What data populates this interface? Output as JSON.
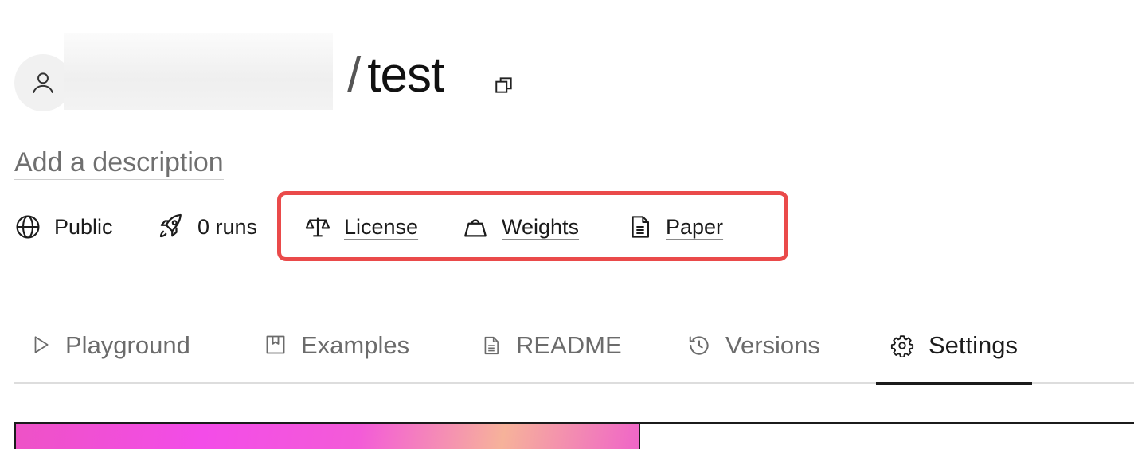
{
  "header": {
    "slash": "/",
    "model_name": "test"
  },
  "description_placeholder": "Add a description",
  "meta": {
    "visibility": "Public",
    "runs": "0 runs",
    "license": "License",
    "weights": "Weights",
    "paper": "Paper"
  },
  "tabs": [
    {
      "label": "Playground",
      "icon": "play-icon"
    },
    {
      "label": "Examples",
      "icon": "bookmark-icon"
    },
    {
      "label": "README",
      "icon": "document-icon"
    },
    {
      "label": "Versions",
      "icon": "history-icon"
    },
    {
      "label": "Settings",
      "icon": "gear-icon",
      "active": true
    }
  ],
  "colors": {
    "highlight": "#ea4a4a",
    "text": "#1b1b1b",
    "muted": "#6b6b6b"
  }
}
